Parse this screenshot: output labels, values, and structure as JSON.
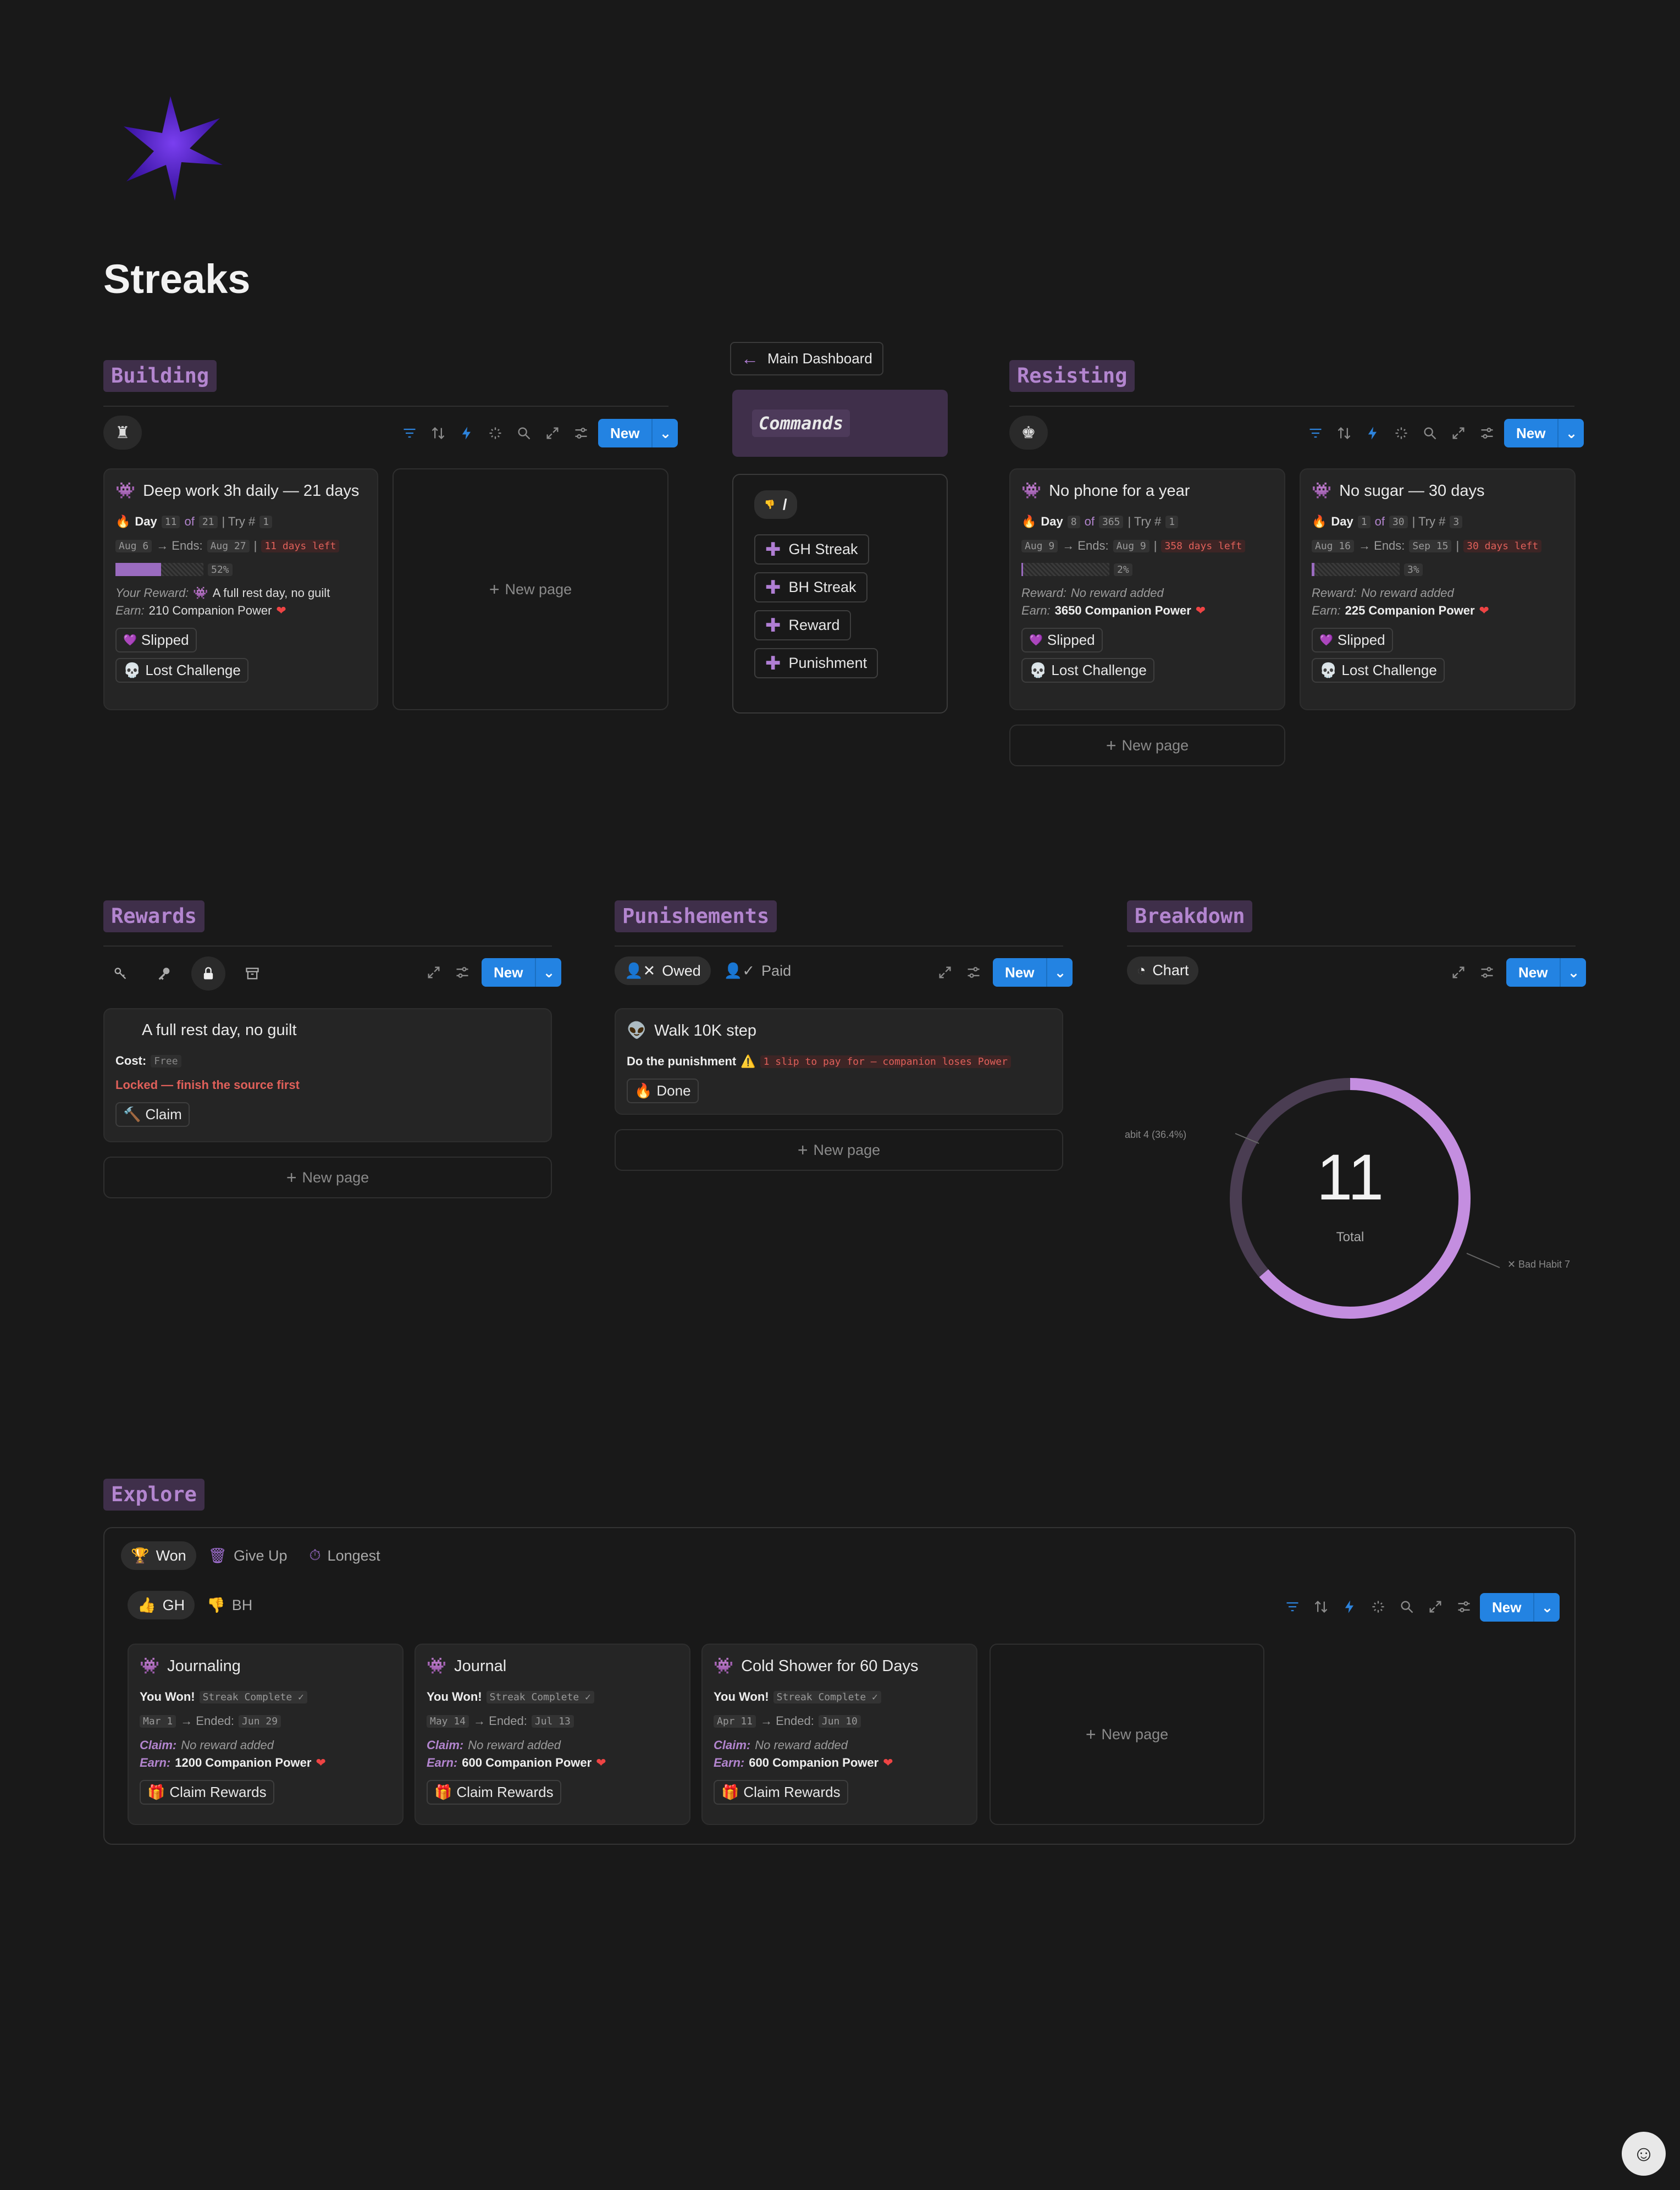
{
  "page": {
    "title": "Streaks"
  },
  "building": {
    "heading": "Building",
    "new_label": "New",
    "cards": [
      {
        "title": "Deep work 3h daily — 21 days",
        "day_label": "Day",
        "day": "11",
        "of": "of",
        "total": "21",
        "try_label": "| Try #",
        "try": "1",
        "start": "Aug 6",
        "ends_label": "→ Ends:",
        "end": "Aug 27",
        "sep": "|",
        "left": "11 days left",
        "progress": 52,
        "progress_label": "52%",
        "reward_label": "Your Reward:",
        "reward": "A full rest day, no guilt",
        "earn_label": "Earn:",
        "earn": "210 Companion Power",
        "tag1": "Slipped",
        "tag2": "Lost Challenge"
      }
    ],
    "new_page": "New page"
  },
  "commands": {
    "back_button": "Main Dashboard",
    "title": "Commands",
    "slash": "/",
    "buttons": [
      "GH Streak",
      "BH Streak",
      "Reward",
      "Punishment"
    ]
  },
  "resisting": {
    "heading": "Resisting",
    "new_label": "New",
    "cards": [
      {
        "title": "No phone for a year",
        "day_label": "Day",
        "day": "8",
        "of": "of",
        "total": "365",
        "try_label": "| Try #",
        "try": "1",
        "start": "Aug 9",
        "ends_label": "→ Ends:",
        "end": "Aug 9",
        "sep": "|",
        "left": "358 days left",
        "progress": 2,
        "progress_label": "2%",
        "reward_label": "Reward:",
        "reward": "No reward added",
        "earn_label": "Earn:",
        "earn": "3650 Companion Power",
        "tag1": "Slipped",
        "tag2": "Lost Challenge"
      },
      {
        "title": "No sugar — 30 days",
        "day_label": "Day",
        "day": "1",
        "of": "of",
        "total": "30",
        "try_label": "| Try #",
        "try": "3",
        "start": "Aug 16",
        "ends_label": "→ Ends:",
        "end": "Sep 15",
        "sep": "|",
        "left": "30 days left",
        "progress": 3,
        "progress_label": "3%",
        "reward_label": "Reward:",
        "reward": "No reward added",
        "earn_label": "Earn:",
        "earn": "225 Companion Power",
        "tag1": "Slipped",
        "tag2": "Lost Challenge"
      }
    ],
    "new_page": "New page"
  },
  "rewards": {
    "heading": "Rewards",
    "new_label": "New",
    "card": {
      "title": "A full rest day, no guilt",
      "cost_label": "Cost:",
      "cost": "Free",
      "locked": "Locked — finish the source first",
      "claim": "Claim"
    },
    "new_page": "New page"
  },
  "punishments": {
    "heading": "Punishements",
    "tab_owed": "Owed",
    "tab_paid": "Paid",
    "new_label": "New",
    "card": {
      "title": "Walk 10K step",
      "do_label": "Do the punishment",
      "warning": "1 slip to pay for — companion loses Power",
      "done": "Done"
    },
    "new_page": "New page"
  },
  "breakdown": {
    "heading": "Breakdown",
    "tab": "Chart",
    "new_label": "New",
    "center_value": "11",
    "center_label": "Total",
    "label_left": "abit  4 (36.4%)",
    "label_right": "Bad Habit  7"
  },
  "chart_data": {
    "type": "pie",
    "categories": [
      "Good Habit",
      "Bad Habit"
    ],
    "values": [
      4,
      7
    ],
    "total": 11,
    "colors": [
      "#4a3d52",
      "#c48ee0"
    ]
  },
  "explore": {
    "heading": "Explore",
    "tabs": [
      "Won",
      "Give Up",
      "Longest"
    ],
    "subtabs": [
      "GH",
      "BH"
    ],
    "new_label": "New",
    "cards": [
      {
        "title": "Journaling",
        "won": "You Won!",
        "complete": "Streak Complete ✓",
        "start": "Mar 1",
        "ended_label": "→ Ended:",
        "end": "Jun 29",
        "claim_label": "Claim:",
        "claim": "No reward added",
        "earn_label": "Earn:",
        "earn": "1200 Companion Power",
        "button": "Claim Rewards"
      },
      {
        "title": "Journal",
        "won": "You Won!",
        "complete": "Streak Complete ✓",
        "start": "May 14",
        "ended_label": "→ Ended:",
        "end": "Jul 13",
        "claim_label": "Claim:",
        "claim": "No reward added",
        "earn_label": "Earn:",
        "earn": "600 Companion Power",
        "button": "Claim Rewards"
      },
      {
        "title": "Cold Shower for 60 Days",
        "won": "You Won!",
        "complete": "Streak Complete ✓",
        "start": "Apr 11",
        "ended_label": "→ Ended:",
        "end": "Jun 10",
        "claim_label": "Claim:",
        "claim": "No reward added",
        "earn_label": "Earn:",
        "earn": "600 Companion Power",
        "button": "Claim Rewards"
      }
    ],
    "new_page": "New page"
  },
  "colors": {
    "background": "#191919",
    "accent": "#2383e2",
    "heading_purple": "#b385cf",
    "danger": "#e0605a"
  }
}
